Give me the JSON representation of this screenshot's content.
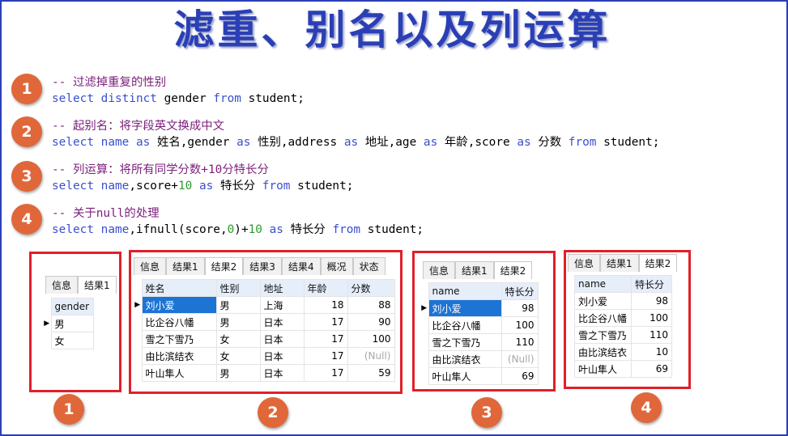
{
  "title": "滤重、别名以及列运算",
  "colors": {
    "title": "#2b3fb5",
    "badge": "#e0673a",
    "panel_border": "#e0202a",
    "comment": "#7a1f7a",
    "keyword": "#3a4fd0",
    "number": "#2e9a2e",
    "selection": "#1d74d4"
  },
  "badges": [
    "1",
    "2",
    "3",
    "4"
  ],
  "code": {
    "s1_comment": "-- 过滤掉重复的性别",
    "s1": [
      "select",
      " ",
      "distinct",
      " gender ",
      "from",
      " student;"
    ],
    "s2_comment": "-- 起别名：将字段英文换成中文",
    "s2": [
      "select",
      " ",
      "name",
      " ",
      "as",
      " 姓名,gender ",
      "as",
      " 性别,address ",
      "as",
      " 地址,age ",
      "as",
      " 年龄,score ",
      "as",
      " 分数 ",
      "from",
      " student;"
    ],
    "s3_comment": "-- 列运算：将所有同学分数+10分特长分",
    "s3": [
      "select",
      " ",
      "name",
      ",score+",
      "10",
      " ",
      "as",
      " 特长分 ",
      "from",
      " student;"
    ],
    "s4_comment": "-- 关于null的处理",
    "s4": [
      "select",
      " ",
      "name",
      ",ifnull(score,",
      "0",
      ")+",
      "10",
      " ",
      "as",
      " 特长分 ",
      "from",
      " student;"
    ]
  },
  "result1": {
    "tabs": [
      "信息",
      "结果1"
    ],
    "columns": [
      "gender"
    ],
    "rows": [
      [
        "男"
      ],
      [
        "女"
      ]
    ]
  },
  "result2": {
    "tabs": [
      "信息",
      "结果1",
      "结果2",
      "结果3",
      "结果4",
      "概况",
      "状态"
    ],
    "columns": [
      "姓名",
      "性别",
      "地址",
      "年龄",
      "分数"
    ],
    "rows": [
      [
        "刘小爱",
        "男",
        "上海",
        "18",
        "88"
      ],
      [
        "比企谷八幡",
        "男",
        "日本",
        "17",
        "90"
      ],
      [
        "雪之下雪乃",
        "女",
        "日本",
        "17",
        "100"
      ],
      [
        "由比滨结衣",
        "女",
        "日本",
        "17",
        "(Null)"
      ],
      [
        "叶山隼人",
        "男",
        "日本",
        "17",
        "59"
      ]
    ]
  },
  "result3": {
    "tabs": [
      "信息",
      "结果1",
      "结果2"
    ],
    "columns": [
      "name",
      "特长分"
    ],
    "rows": [
      [
        "刘小爱",
        "98"
      ],
      [
        "比企谷八幡",
        "100"
      ],
      [
        "雪之下雪乃",
        "110"
      ],
      [
        "由比滨结衣",
        "(Null)"
      ],
      [
        "叶山隼人",
        "69"
      ]
    ]
  },
  "result4": {
    "tabs": [
      "信息",
      "结果1",
      "结果2"
    ],
    "columns": [
      "name",
      "特长分"
    ],
    "rows": [
      [
        "刘小爱",
        "98"
      ],
      [
        "比企谷八幡",
        "100"
      ],
      [
        "雪之下雪乃",
        "110"
      ],
      [
        "由比滨结衣",
        "10"
      ],
      [
        "叶山隼人",
        "69"
      ]
    ]
  }
}
